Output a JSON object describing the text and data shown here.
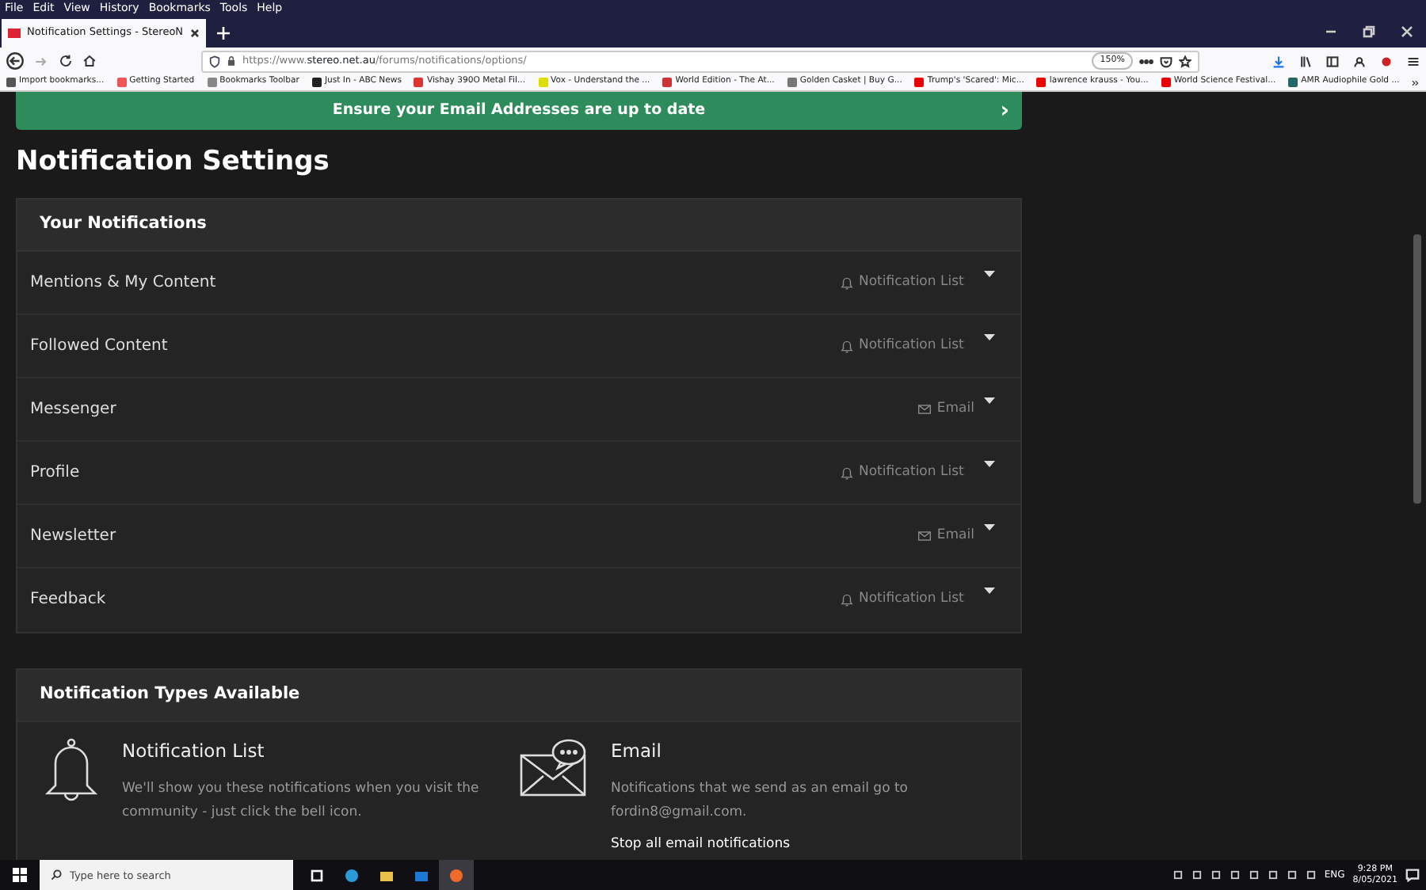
{
  "menu": [
    "File",
    "Edit",
    "View",
    "History",
    "Bookmarks",
    "Tools",
    "Help"
  ],
  "tab": {
    "title": "Notification Settings - StereoN",
    "selected": true
  },
  "url": {
    "scheme": "https://www.",
    "host": "stereo.net.au",
    "path": "/forums/notifications/options/"
  },
  "zoom": "150%",
  "bookmarks": [
    "Import bookmarks...",
    "Getting Started",
    "Bookmarks Toolbar",
    "Just In - ABC News",
    "Vishay 390O Metal Fil...",
    "Vox - Understand the ...",
    "World Edition - The At...",
    "Golden Casket | Buy G...",
    "Trump's 'Scared': Mic...",
    "lawrence krauss - You...",
    "World Science Festival...",
    "AMR Audiophile Gold ..."
  ],
  "banner": {
    "text": "Ensure your Email Addresses are up to date",
    "arrow": "›"
  },
  "page_title": "Notification Settings",
  "notifications": {
    "header": "Your Notifications",
    "rows": [
      {
        "label": "Mentions & My Content",
        "kind": "bell",
        "method": "Notification List"
      },
      {
        "label": "Followed Content",
        "kind": "bell",
        "method": "Notification List"
      },
      {
        "label": "Messenger",
        "kind": "email",
        "method": "Email"
      },
      {
        "label": "Profile",
        "kind": "bell",
        "method": "Notification List"
      },
      {
        "label": "Newsletter",
        "kind": "email",
        "method": "Email"
      },
      {
        "label": "Feedback",
        "kind": "bell",
        "method": "Notification List"
      }
    ]
  },
  "types": {
    "header": "Notification Types Available",
    "items": [
      {
        "kind": "bell",
        "title": "Notification List",
        "description": "We'll show you these notifications when you visit the community - just click the bell icon."
      },
      {
        "kind": "email",
        "title": "Email",
        "description": "Notifications that we send as an email go to fordin8@gmail.com.",
        "link": "Stop all email notifications"
      }
    ]
  },
  "taskbar": {
    "search_placeholder": "Type here to search",
    "language": "ENG",
    "time": "9:28 PM",
    "date": "8/05/2021"
  }
}
